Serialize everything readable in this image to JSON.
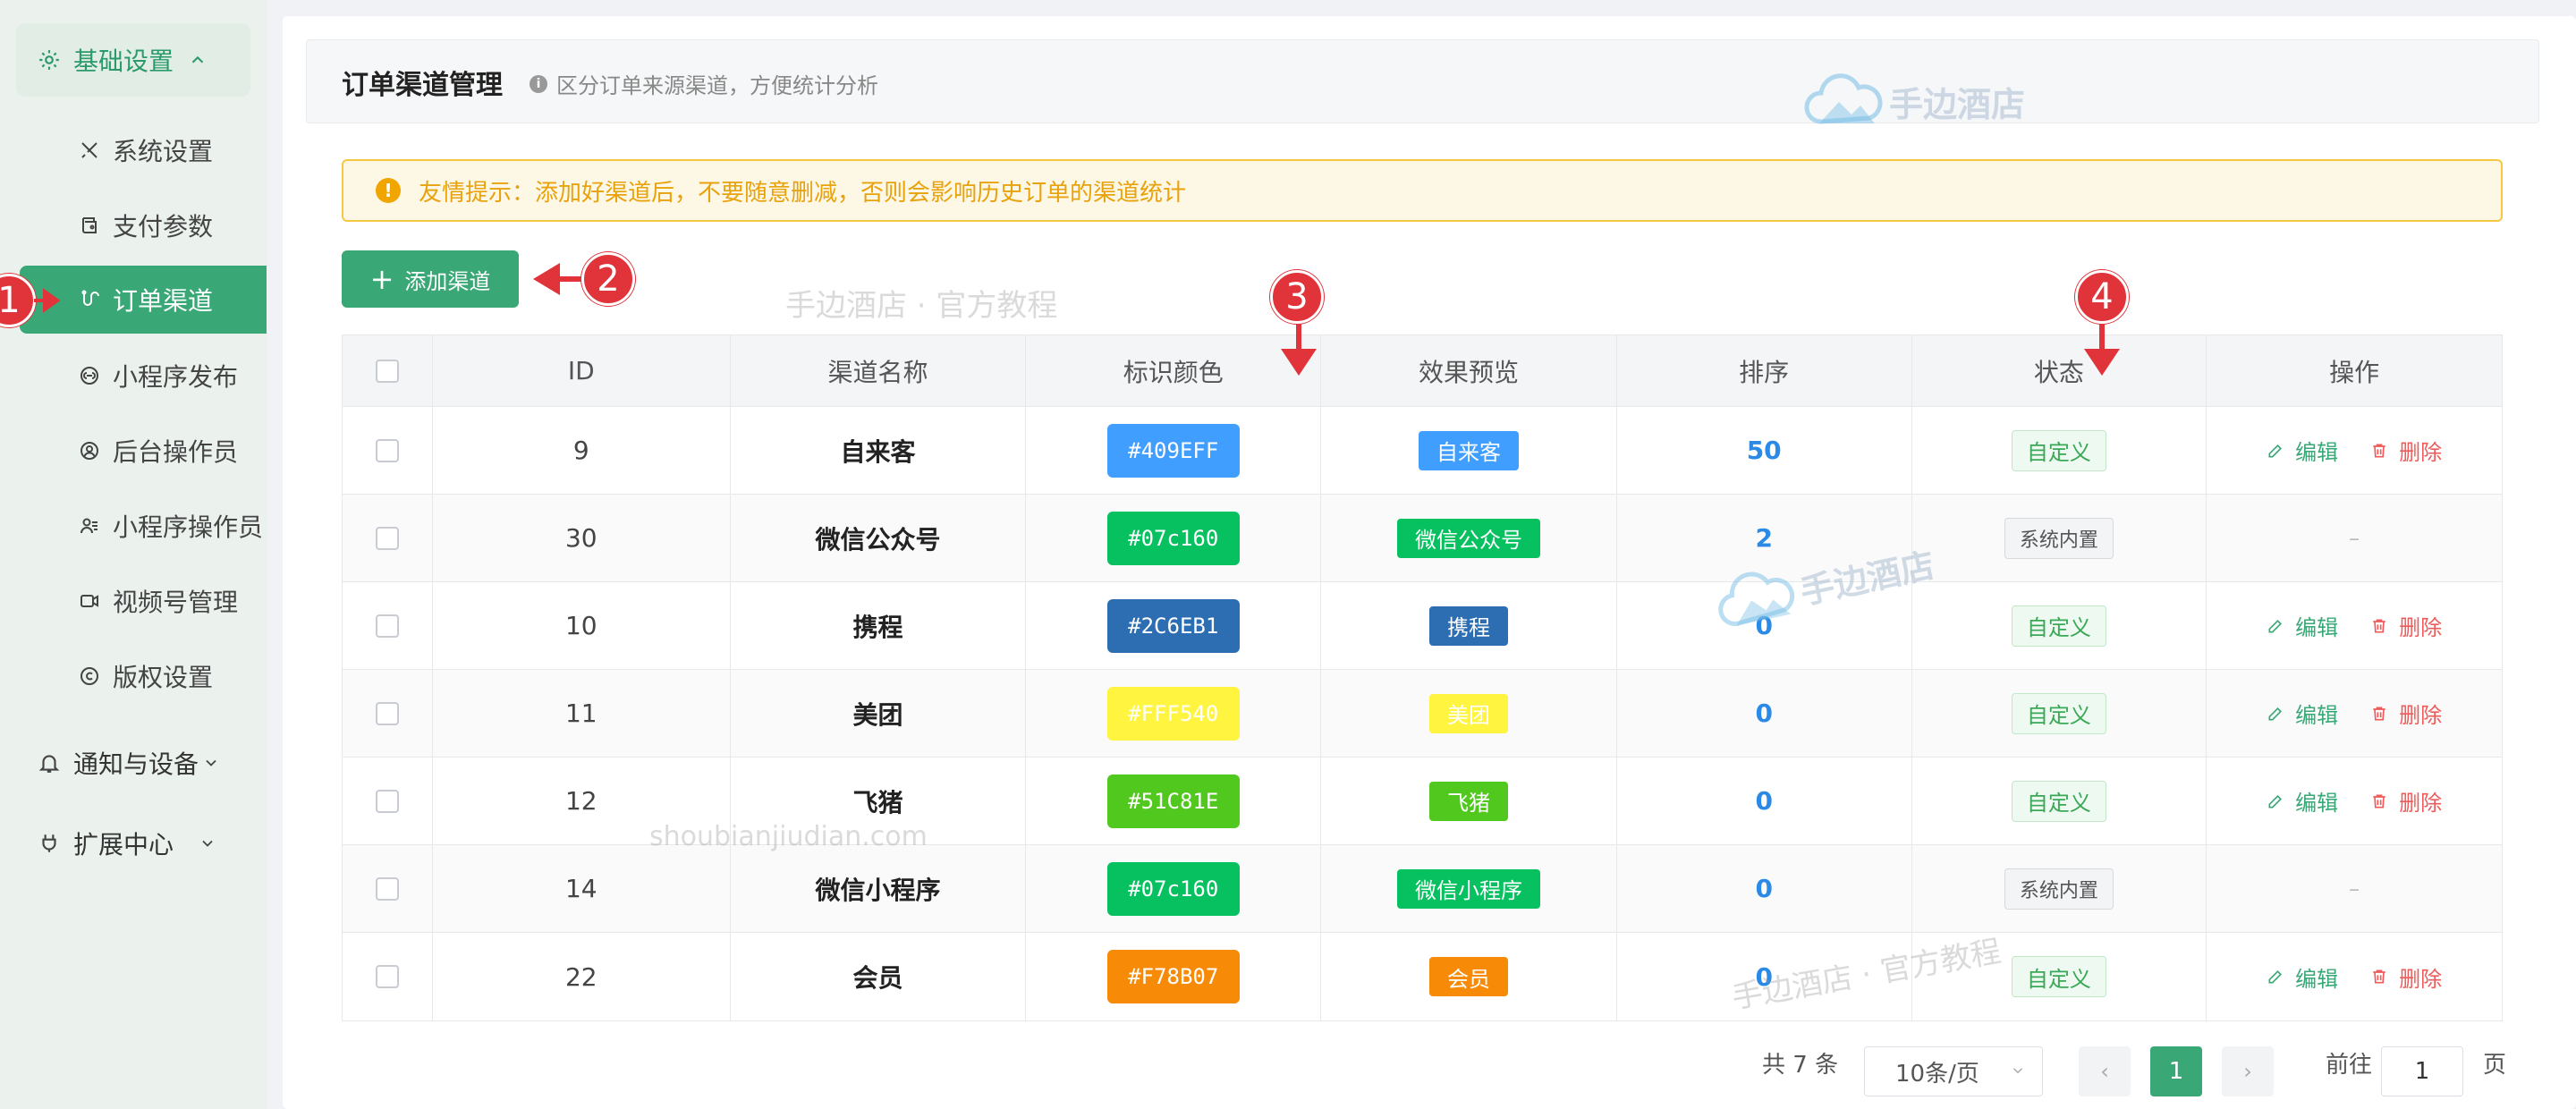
{
  "sidebar": {
    "groups": [
      {
        "label": "基础设置",
        "icon": "gear-icon",
        "chevron": "chevron-up-icon"
      },
      {
        "label": "通知与设备",
        "icon": "bell-icon",
        "chevron": "chevron-down-icon"
      },
      {
        "label": "扩展中心",
        "icon": "plug-icon",
        "chevron": "chevron-down-icon"
      }
    ],
    "items": [
      {
        "label": "系统设置",
        "icon": "tools-icon"
      },
      {
        "label": "支付参数",
        "icon": "wallet-icon"
      },
      {
        "label": "订单渠道",
        "icon": "channel-icon"
      },
      {
        "label": "小程序发布",
        "icon": "miniapp-icon"
      },
      {
        "label": "后台操作员",
        "icon": "user-circle-icon"
      },
      {
        "label": "小程序操作员",
        "icon": "users-icon"
      },
      {
        "label": "视频号管理",
        "icon": "video-icon"
      },
      {
        "label": "版权设置",
        "icon": "copyright-icon"
      }
    ]
  },
  "header": {
    "title": "订单渠道管理",
    "subtitle": "区分订单来源渠道，方便统计分析"
  },
  "tip": {
    "text": "友情提示：添加好渠道后，不要随意删减，否则会影响历史订单的渠道统计"
  },
  "toolbar": {
    "add_label": "添加渠道"
  },
  "table": {
    "columns": [
      "ID",
      "渠道名称",
      "标识颜色",
      "效果预览",
      "排序",
      "状态",
      "操作"
    ],
    "rows": [
      {
        "id": "9",
        "name": "自来客",
        "color": "#409EFF",
        "preview": "自来客",
        "sort": "50",
        "status": "自定义",
        "custom": true
      },
      {
        "id": "30",
        "name": "微信公众号",
        "color": "#07c160",
        "preview": "微信公众号",
        "sort": "2",
        "status": "系统内置",
        "custom": false
      },
      {
        "id": "10",
        "name": "携程",
        "color": "#2C6EB1",
        "preview": "携程",
        "sort": "0",
        "status": "自定义",
        "custom": true
      },
      {
        "id": "11",
        "name": "美团",
        "color": "#FFF540",
        "preview": "美团",
        "sort": "0",
        "status": "自定义",
        "custom": true
      },
      {
        "id": "12",
        "name": "飞猪",
        "color": "#51C81E",
        "preview": "飞猪",
        "sort": "0",
        "status": "自定义",
        "custom": true
      },
      {
        "id": "14",
        "name": "微信小程序",
        "color": "#07c160",
        "preview": "微信小程序",
        "sort": "0",
        "status": "系统内置",
        "custom": false
      },
      {
        "id": "22",
        "name": "会员",
        "color": "#F78B07",
        "preview": "会员",
        "sort": "0",
        "status": "自定义",
        "custom": true
      }
    ],
    "edit_label": "编辑",
    "delete_label": "删除",
    "empty_op": "–"
  },
  "pagination": {
    "total": "共 7 条",
    "page_size": "10条/页",
    "current": "1",
    "goto_prefix": "前往",
    "goto_value": "1",
    "goto_suffix": "页"
  },
  "markers": [
    "1",
    "2",
    "3",
    "4"
  ],
  "watermarks": {
    "brand": "手边酒店",
    "tutorial": "手边酒店 · 官方教程",
    "domain": "shoubianjiudian.com"
  },
  "colors": {
    "accent": "#3aa876",
    "marker": "#e0333a",
    "link": "#2b8ae6",
    "danger": "#f05a5a",
    "warning": "#f0a500"
  }
}
